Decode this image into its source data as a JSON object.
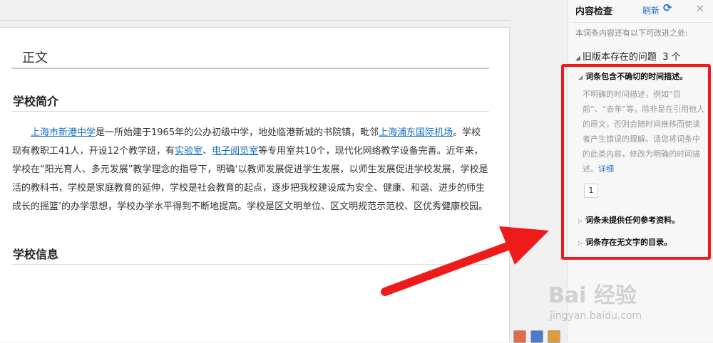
{
  "editor": {
    "section_title": "正文",
    "heading_intro": "学校简介",
    "heading_info": "学校信息",
    "paragraph": {
      "link1": "上海市新港中学",
      "t1": "是一所始建于1965年的公办初级中学，地处临港新城的书院镇，毗邻",
      "link2": "上海浦东国际机场",
      "t2": "。学校现有教职工41人，开设12个教学班，有",
      "link3": "实验室",
      "t3": "、",
      "link4": "电子阅览室",
      "t4": "等专用室共10个，现代化网络教学设备完善。近年来，学校在“阳光育人、多元发展”教学理念的指导下，明确‘以教师发展促进学生发展，以师生发展促进学校发展，学校是活的教科书，学校是家庭教育的延伸，学校是社会教育的起点，逐步把我校建设成为安全、健康、和谐、进步的师生成长的摇篮’的办学思想，学校办学水平得到不断地提高。学校是区文明单位、区文明规范示范校、区优秀健康校园。"
    }
  },
  "panel": {
    "title": "内容检查",
    "refresh": "刷新",
    "refresh_icon": "refresh-icon",
    "close": "×",
    "description": "本词条内容还有以下可改进之处:",
    "old_issues_label": "旧版本存在的问题",
    "old_issues_count": "3 个",
    "issues": [
      {
        "title": "词条包含不确切的时间描述。",
        "body": "不明确的时间描述，例如“目前”、“去年”等，除非是在引用他人的原文，否则会随时间推移而使读者产生错误的理解。请您将词条中的此类内容，修改为明确的时间描述。",
        "more": "详细",
        "page": "1"
      },
      {
        "title": "词条未提供任何参考资料。"
      },
      {
        "title": "词条存在无文字的目录。"
      }
    ]
  },
  "watermark": {
    "brand": "Bai 经验",
    "url": "jingyan.baidu.com"
  },
  "colors": {
    "link": "#136ec2",
    "annotation_red": "#ee1b1b",
    "accent_blue": "#2b6fc9"
  }
}
